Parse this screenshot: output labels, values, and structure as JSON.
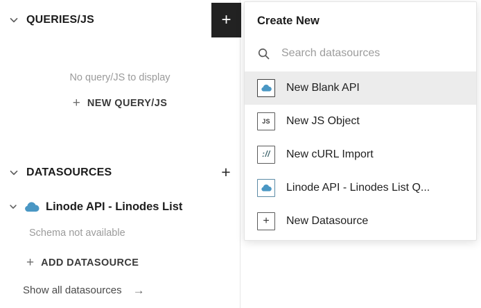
{
  "colors": {
    "accent_blue": "#4a97c4",
    "add_button_bg": "#222222",
    "highlight_bg": "#ececec"
  },
  "icons": {
    "plus_glyph": "+",
    "arrow_right_glyph": "→"
  },
  "sidebar": {
    "queries": {
      "title": "QUERIES/JS",
      "empty_message": "No query/JS to display",
      "new_button": "NEW QUERY/JS"
    },
    "datasources": {
      "title": "DATASOURCES",
      "item_name": "Linode API - Linodes List",
      "schema_status": "Schema not available",
      "add_button": "ADD DATASOURCE",
      "show_all": "Show all datasources"
    }
  },
  "dropdown": {
    "title": "Create New",
    "search_placeholder": "Search datasources",
    "items": [
      {
        "label": "New Blank API",
        "icon": "cloud-icon",
        "highlighted": true
      },
      {
        "label": "New JS Object",
        "icon": "js-icon",
        "icon_text": "JS"
      },
      {
        "label": "New cURL Import",
        "icon": "curl-icon",
        "icon_text": "://"
      },
      {
        "label": "Linode API - Linodes List Q...",
        "icon": "cloud-icon"
      },
      {
        "label": "New Datasource",
        "icon": "plus-icon",
        "icon_text": "+"
      }
    ]
  }
}
